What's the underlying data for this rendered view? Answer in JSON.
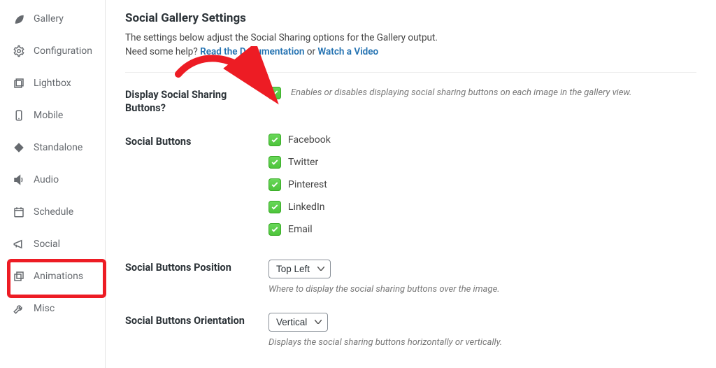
{
  "sidebar": {
    "items": [
      {
        "label": "Gallery"
      },
      {
        "label": "Configuration"
      },
      {
        "label": "Lightbox"
      },
      {
        "label": "Mobile"
      },
      {
        "label": "Standalone"
      },
      {
        "label": "Audio"
      },
      {
        "label": "Schedule"
      },
      {
        "label": "Social"
      },
      {
        "label": "Animations"
      },
      {
        "label": "Misc"
      }
    ]
  },
  "header": {
    "title": "Social Gallery Settings",
    "intro_line1": "The settings below adjust the Social Sharing options for the Gallery output.",
    "intro_help_prefix": "Need some help? ",
    "intro_doc_link": "Read the Documentation",
    "intro_or": " or ",
    "intro_video_link": "Watch a Video"
  },
  "fields": {
    "display": {
      "label": "Display Social Sharing Buttons?",
      "desc": "Enables or disables displaying social sharing buttons on each image in the gallery view."
    },
    "buttons": {
      "label": "Social Buttons",
      "opts": [
        {
          "label": "Facebook"
        },
        {
          "label": "Twitter"
        },
        {
          "label": "Pinterest"
        },
        {
          "label": "LinkedIn"
        },
        {
          "label": "Email"
        }
      ]
    },
    "position": {
      "label": "Social Buttons Position",
      "value": "Top Left",
      "desc": "Where to display the social sharing buttons over the image."
    },
    "orientation": {
      "label": "Social Buttons Orientation",
      "value": "Vertical",
      "desc": "Displays the social sharing buttons horizontally or vertically."
    }
  }
}
